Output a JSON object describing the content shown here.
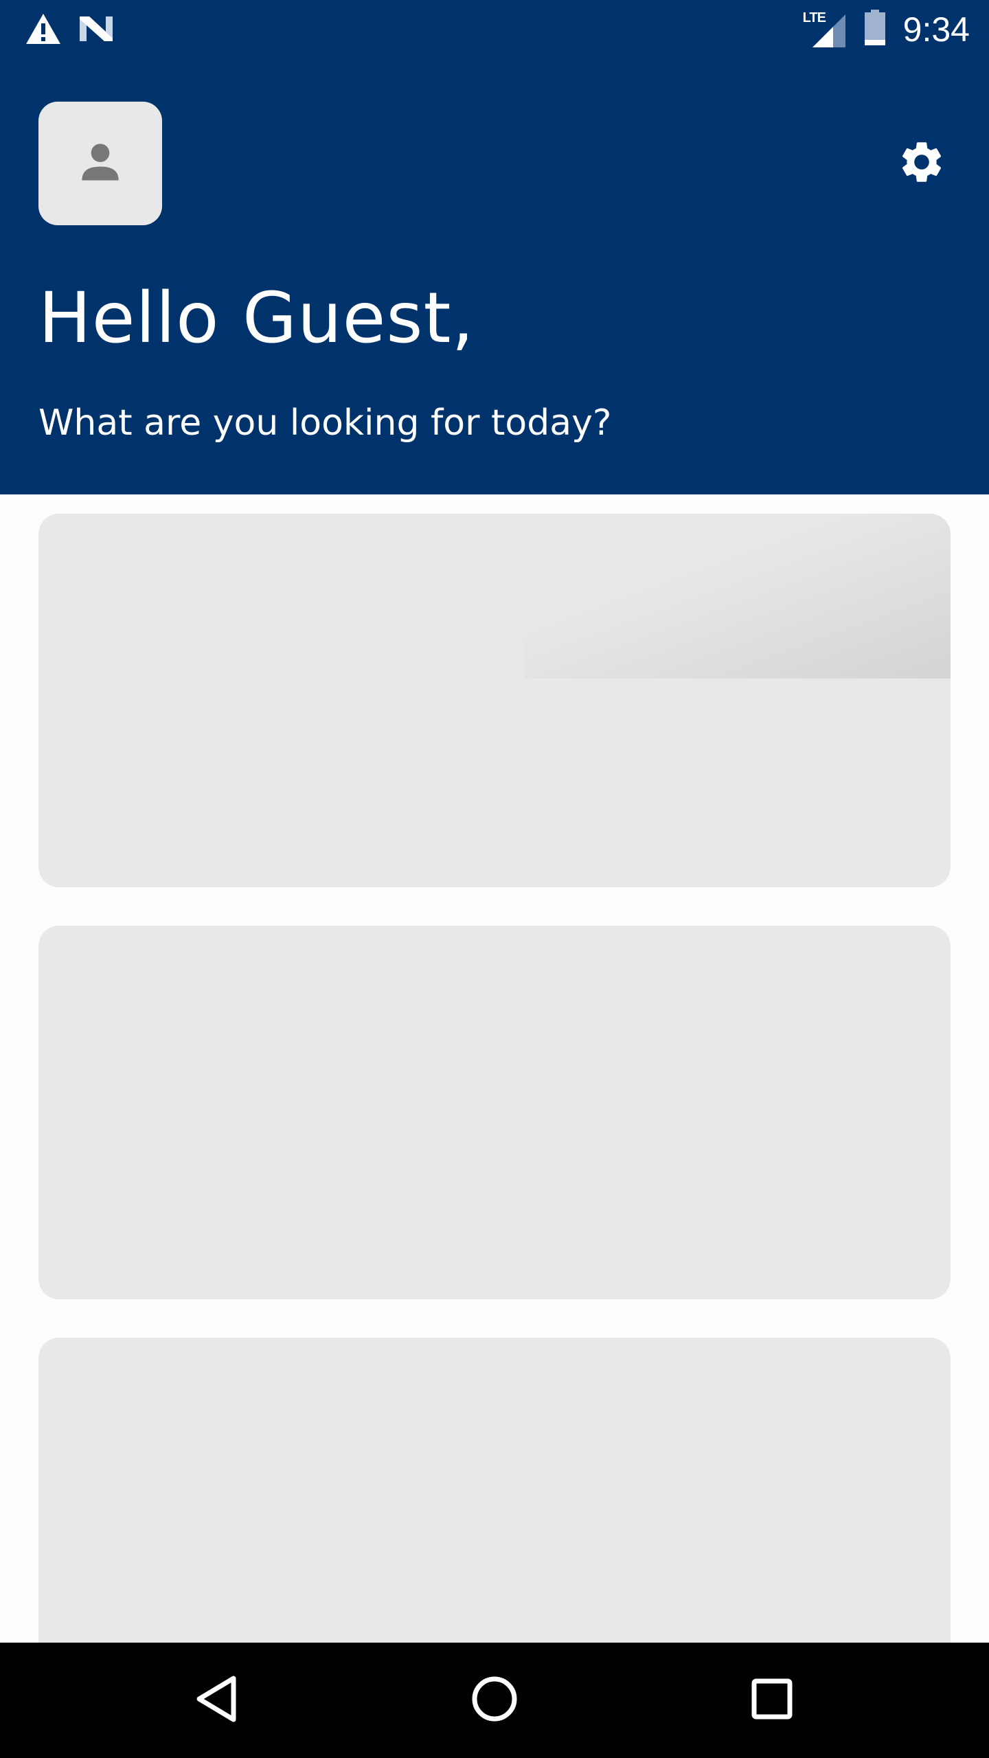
{
  "status_bar": {
    "time": "9:34",
    "network": "LTE",
    "icons": [
      "warning-icon",
      "n-logo-icon",
      "lte-signal-icon",
      "battery-icon"
    ]
  },
  "header": {
    "greeting": "Hello Guest,",
    "subtitle": "What are you looking for today?",
    "avatar_icon": "person-icon",
    "settings_icon": "gear-icon"
  },
  "cards": [
    {
      "state": "loading-placeholder"
    },
    {
      "state": "loading-placeholder"
    },
    {
      "state": "loading-placeholder"
    }
  ],
  "nav_bar": {
    "buttons": [
      "back-icon",
      "home-icon",
      "recents-icon"
    ]
  },
  "colors": {
    "header_bg": "#00326b",
    "placeholder_bg": "#e8e8e8",
    "avatar_icon": "#777777",
    "page_bg": "#fdfdfd",
    "nav_bg": "#000000"
  }
}
